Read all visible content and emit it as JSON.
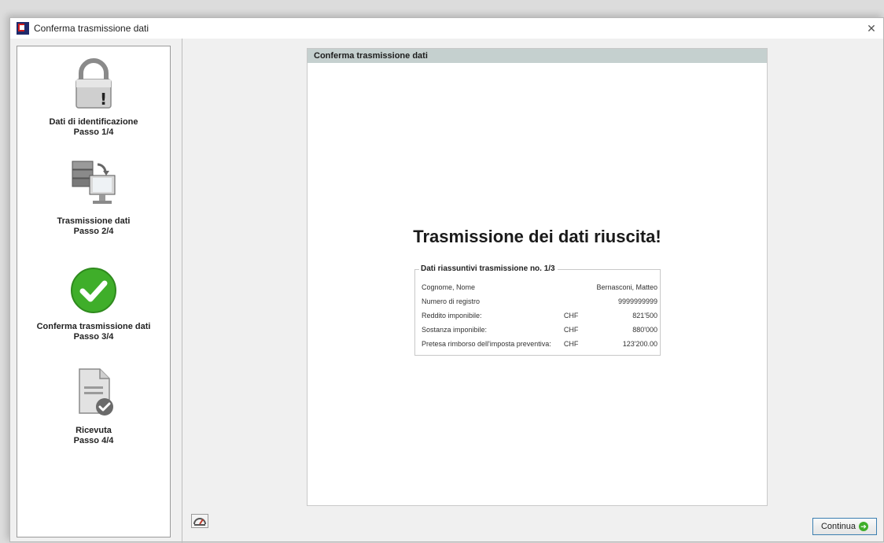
{
  "window": {
    "title": "Conferma trasmissione dati"
  },
  "steps": [
    {
      "label": "Dati di identificazione",
      "sub": "Passo 1/4",
      "icon": "lock-warning-icon"
    },
    {
      "label": "Trasmissione dati",
      "sub": "Passo 2/4",
      "icon": "server-transfer-icon"
    },
    {
      "label": "Conferma trasmissione dati",
      "sub": "Passo 3/4",
      "icon": "checkmark-icon"
    },
    {
      "label": "Ricevuta",
      "sub": "Passo 4/4",
      "icon": "receipt-icon"
    }
  ],
  "main": {
    "header": "Conferma trasmissione dati",
    "headline": "Trasmissione dei dati riuscita!",
    "summary_title": "Dati riassuntivi trasmissione no. 1/3",
    "rows": [
      {
        "label": "Cognome, Nome",
        "currency": "",
        "value": "Bernasconi, Matteo"
      },
      {
        "label": "Numero di registro",
        "currency": "",
        "value": "9999999999"
      },
      {
        "label": "Reddito imponibile:",
        "currency": "CHF",
        "value": "821'500"
      },
      {
        "label": "Sostanza imponibile:",
        "currency": "CHF",
        "value": "880'000"
      },
      {
        "label": "Pretesa rimborso dell'imposta preventiva:",
        "currency": "CHF",
        "value": "123'200.00"
      }
    ]
  },
  "footer": {
    "continue_label": "Continua"
  },
  "colors": {
    "header_bg": "#c5d0cf",
    "accent_green": "#3fae2a",
    "button_border": "#3c7fb1"
  }
}
